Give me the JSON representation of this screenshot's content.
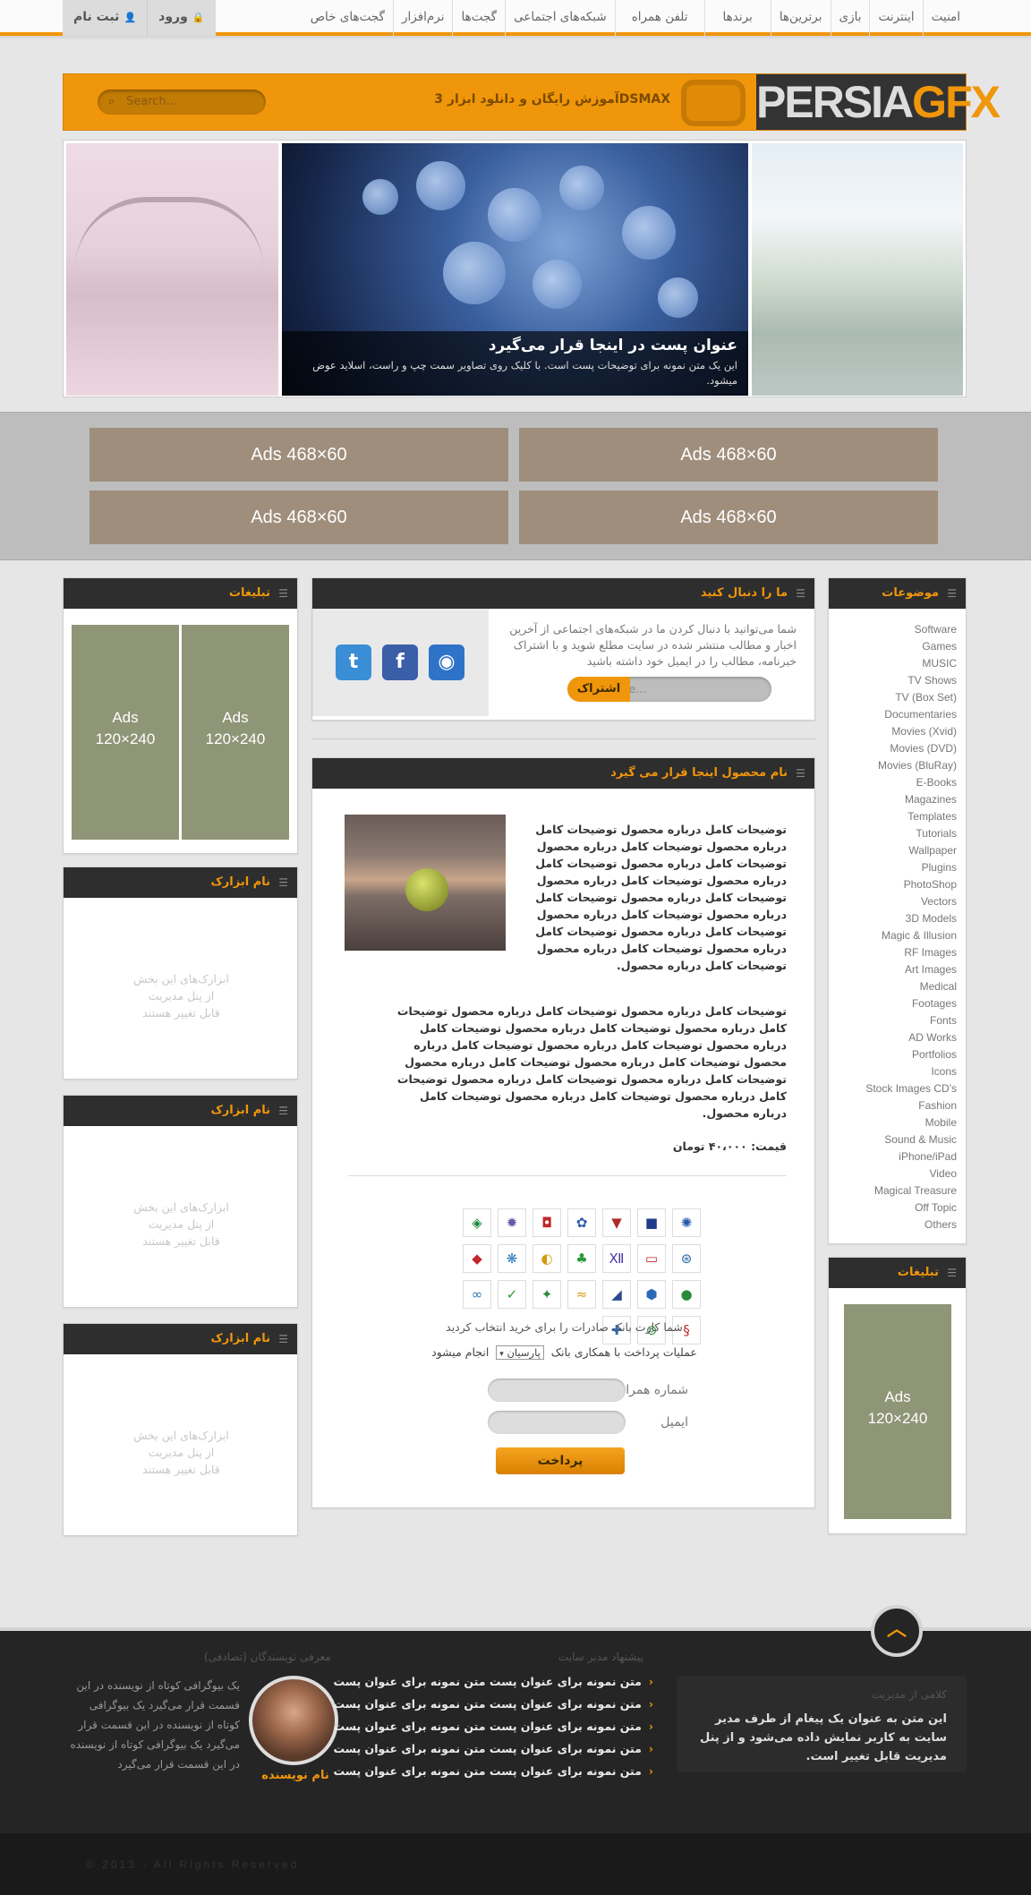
{
  "nav": {
    "items": [
      "امنیت",
      "اینترنت",
      "بازی",
      "برترین‌ها",
      "برندها",
      "تلفن همراه",
      "شبکه‌های اجتماعی",
      "گجت‌ها",
      "نرم‌افزار",
      "گجت‌های خاص"
    ],
    "login": "ورود",
    "signup": "ثبت نام"
  },
  "banner": {
    "logo_a": "PERSIA",
    "logo_b": "GFX",
    "tagline": "آموزش رایگان و دانلود ابزار 3DSMAX",
    "search_placeholder": "Search..."
  },
  "slider": {
    "title": "عنوان پست در اینجا قرار می‌گیرد",
    "desc": "این یک متن نمونه برای توضیحات پست است. با کلیک روی تصاویر سمت چپ و راست، اسلاید عوض میشود."
  },
  "ads_top": [
    "Ads 468×60",
    "Ads 468×60",
    "Ads 468×60",
    "Ads 468×60"
  ],
  "topics": {
    "title": "موضوعات",
    "items": [
      "Software",
      "Games",
      "MUSIC",
      "TV Shows",
      "TV (Box Set)",
      "Documentaries",
      "Movies (Xvid)",
      "Movies (DVD)",
      "Movies (BluRay)",
      "E-Books",
      "Magazines",
      "Templates",
      "Tutorials",
      "Wallpaper",
      "Plugins",
      "PhotoShop",
      "Vectors",
      "3D Models",
      "Magic & Illusion",
      "RF Images",
      "Art Images",
      "Medical",
      "Footages",
      "Fonts",
      "AD Works",
      "Portfolios",
      "Icons",
      "Stock Images CD's",
      "Fashion",
      "Mobile",
      "Sound & Music",
      "iPhone/iPad",
      "Video",
      "Magical Treasure",
      "Off Topic",
      "Others"
    ]
  },
  "right_ad": {
    "title": "تبلیغات",
    "line1": "Ads",
    "line2": "120×240"
  },
  "left_ad": {
    "title": "تبلیغات",
    "line1": "Ads",
    "line2": "120×240"
  },
  "tools": [
    {
      "title": "نام ابزارک",
      "l1": "ابزارک‌های این بخش",
      "l2": "از پنل مدیریت",
      "l3": "قابل تغییر هستند"
    },
    {
      "title": "نام ابزارک",
      "l1": "ابزارک‌های این بخش",
      "l2": "از پنل مدیریت",
      "l3": "قابل تغییر هستند"
    },
    {
      "title": "نام ابزارک",
      "l1": "ابزارک‌های این بخش",
      "l2": "از پنل مدیریت",
      "l3": "قابل تغییر هستند"
    }
  ],
  "follow": {
    "title": "ما را دنبال کنید",
    "text": "شما می‌توانید با دنبال کردن ما در شبکه‌های اجتماعی از آخرین اخبار و مطالب منتشر شده در سایت مطلع شوید و با اشتراک خبرنامه، مطالب را در ایمیل خود داشته باشید",
    "email_placeholder": "Email Here...",
    "subscribe": "اشتراک"
  },
  "product": {
    "title": "نام محصول اینجا قرار می گیرد",
    "desc1": "توضیحات کامل درباره محصول توضیحات کامل درباره محصول توضیحات کامل درباره محصول توضیحات کامل درباره محصول توضیحات کامل درباره محصول توضیحات کامل درباره محصول توضیحات کامل درباره محصول توضیحات کامل درباره محصول توضیحات کامل درباره محصول توضیحات کامل درباره محصول توضیحات کامل درباره محصول توضیحات کامل درباره محصول توضیحات کامل درباره محصول.",
    "desc2": "توضیحات کامل درباره محصول توضیحات کامل درباره محصول توضیحات کامل درباره محصول توضیحات کامل درباره محصول توضیحات کامل درباره محصول توضیحات کامل درباره محصول توضیحات کامل درباره محصول توضیحات کامل درباره محصول توضیحات کامل درباره محصول توضیحات کامل درباره محصول توضیحات کامل درباره محصول توضیحات کامل درباره محصول توضیحات کامل درباره محصول توضیحات کامل درباره محصول.",
    "price": "قیمت: ۴۰،۰۰۰ تومان",
    "bank_selected": "شما کارت بانک صادرات را برای خرید انتخاب کردید",
    "gateway_pre": "عملیات پرداخت با همکاری بانک",
    "gateway_bank": "پارسیان",
    "gateway_post": "انجام میشود",
    "phone_label": "شماره همراه",
    "email_label": "ایمیل",
    "pay": "پرداخت"
  },
  "footer": {
    "authors_title": "معرفی نویسندگان (تصادفی)",
    "author_bio": "یک بیوگرافی کوتاه از نویسنده در این قسمت قرار می‌گیرد یک بیوگرافی کوتاه از نویسنده در این قسمت قرار می‌گیرد یک بیوگرافی کوتاه از نویسنده در این قسمت قرار می‌گیرد",
    "author_name": "نام نویسنده",
    "suggest_title": "پیشنهاد مدیر سایت",
    "links": [
      "متن نمونه برای عنوان پست متن نمونه برای عنوان پست",
      "متن نمونه برای عنوان پست متن نمونه برای عنوان پست",
      "متن نمونه برای عنوان پست متن نمونه برای عنوان پست",
      "متن نمونه برای عنوان پست متن نمونه برای عنوان پست",
      "متن نمونه برای عنوان پست متن نمونه برای عنوان پست"
    ],
    "admin_title": "کلامی از مدیریت",
    "admin_text": "این متن به عنوان یک پیغام از طرف مدیر سایت به کاربر نمایش داده می‌شود و از پنل مدیریت قابل تغییر است.",
    "copyright": "© 2013 - All Rights Reserved."
  },
  "colors": {
    "accent": "#f0960a",
    "dark": "#2e2e2e",
    "ad_brown": "#9e8e7b",
    "ad_olive": "#8f9577"
  },
  "icons": {
    "search": "search-icon",
    "login": "lock-icon",
    "signup": "user-icon",
    "twitter": "twitter-icon",
    "facebook": "facebook-icon",
    "rss": "rss-icon",
    "totop": "chevron-up-icon"
  }
}
